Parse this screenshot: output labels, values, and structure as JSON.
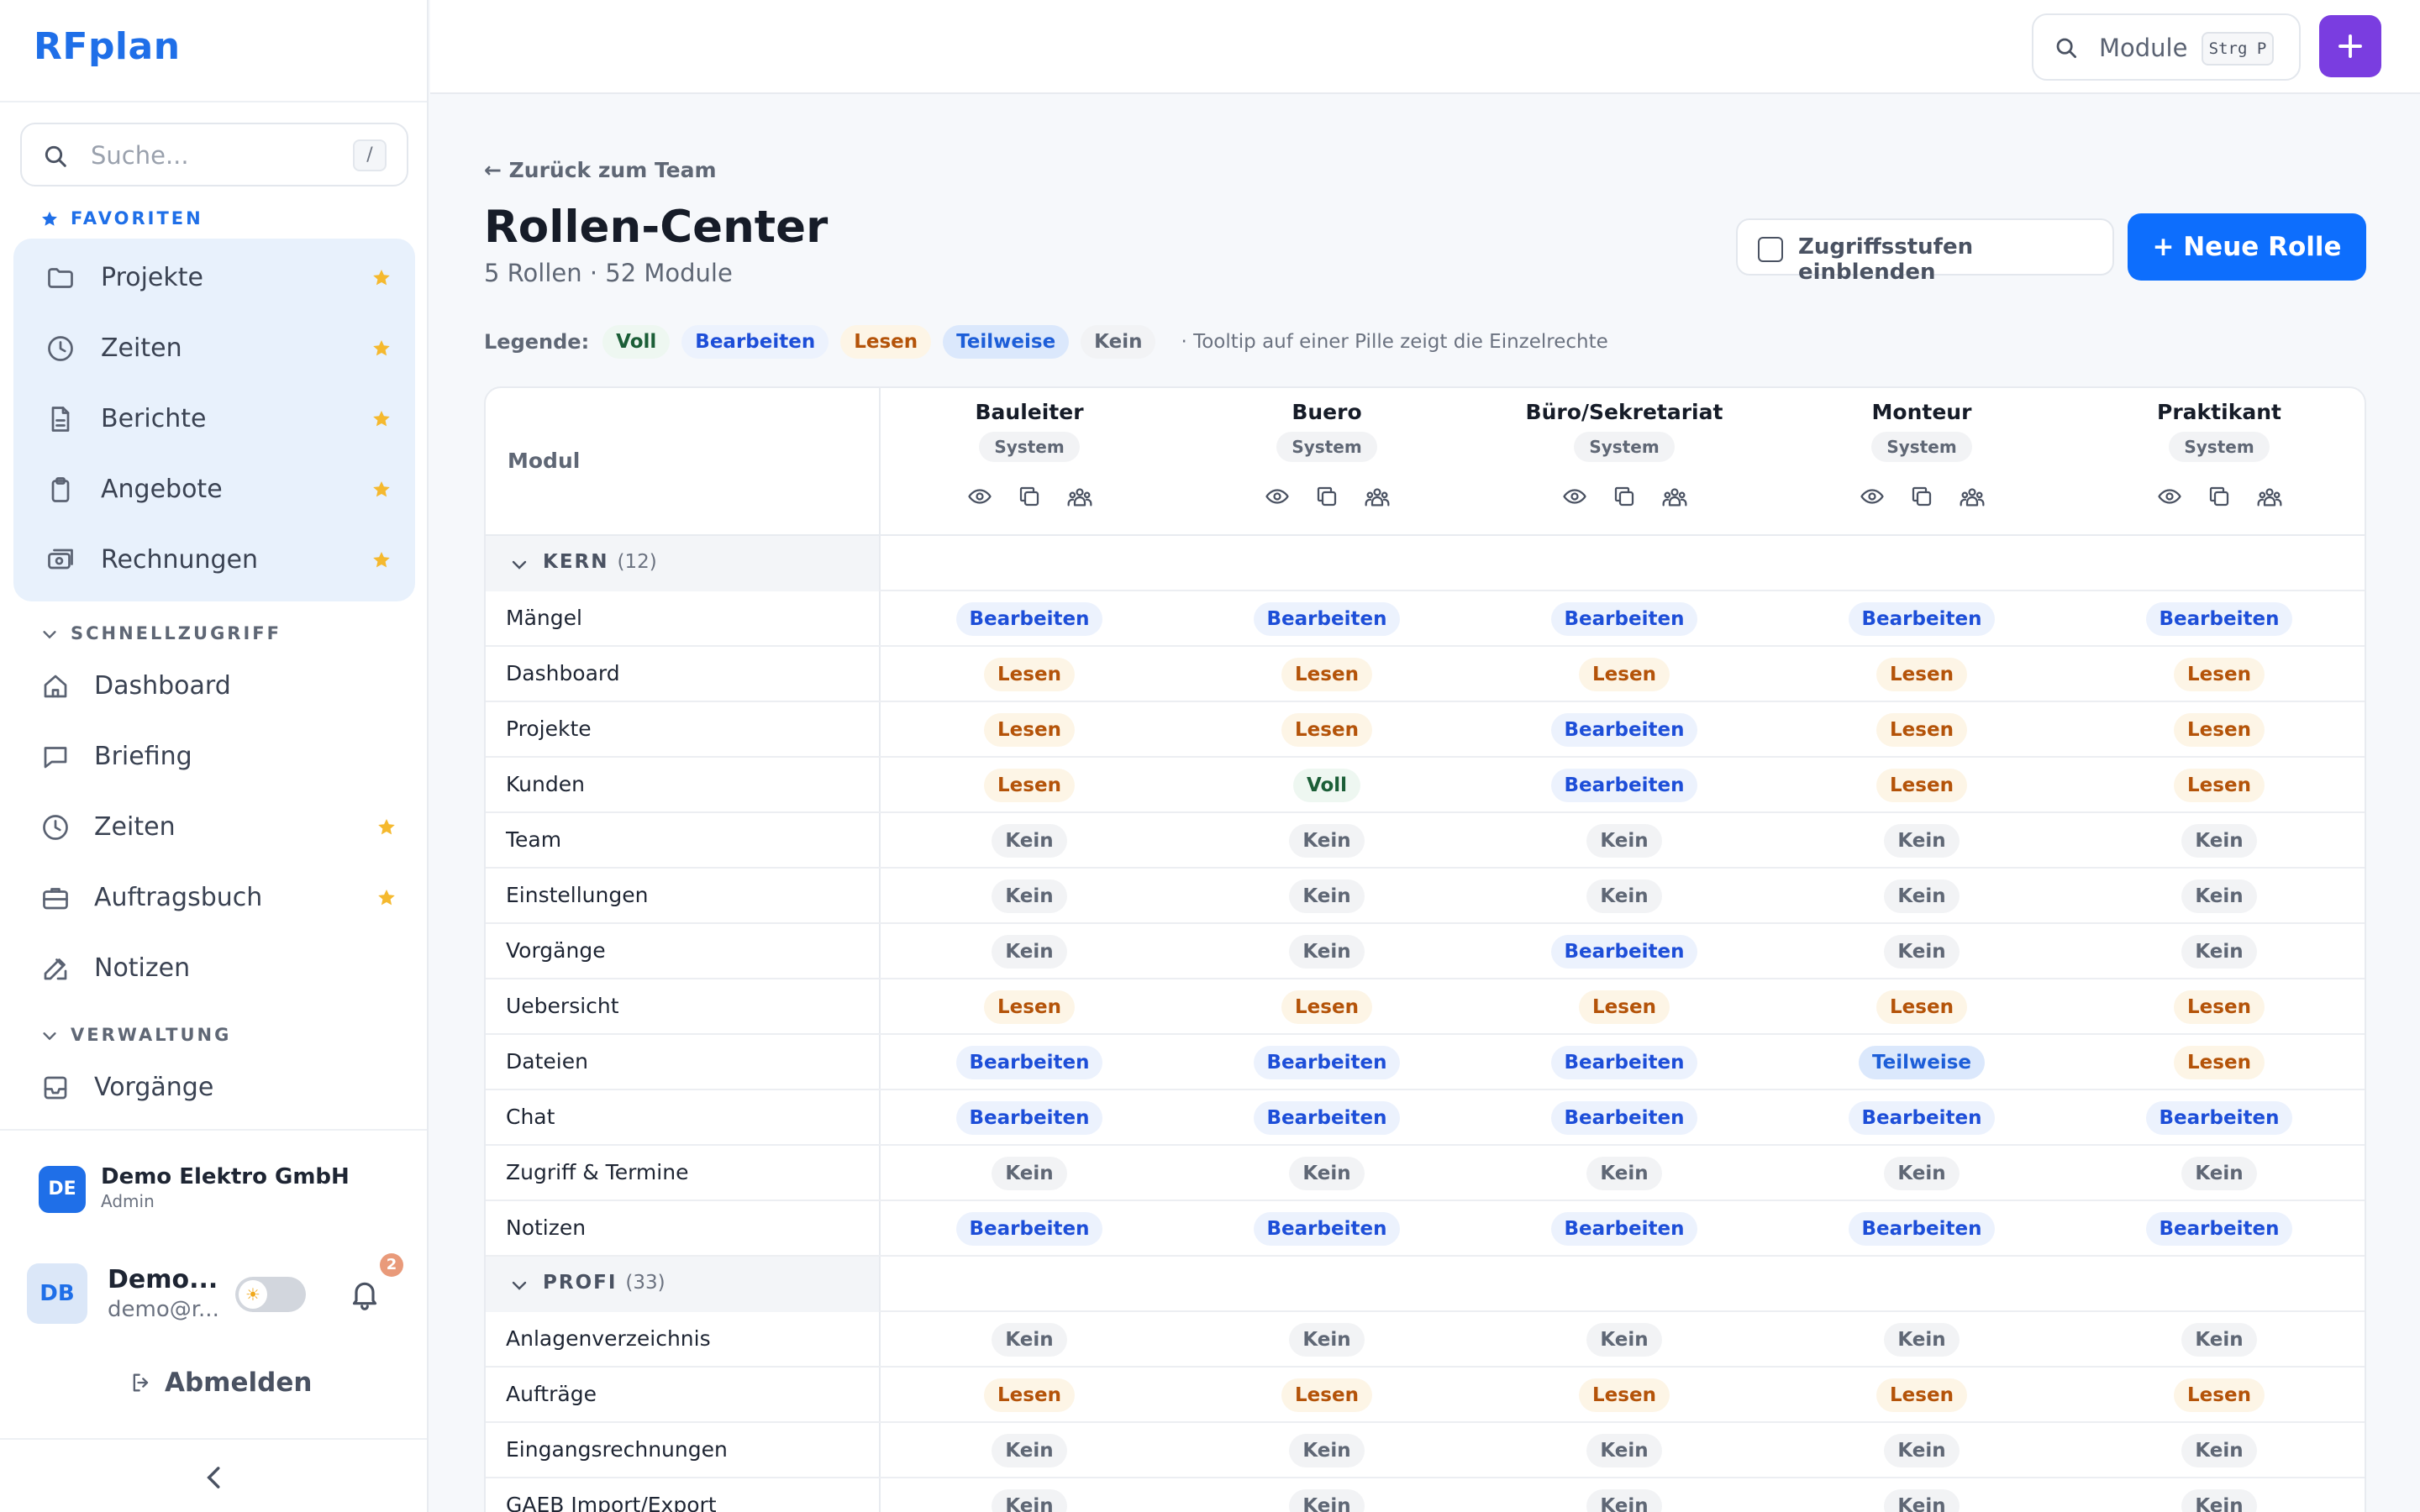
{
  "app": {
    "brand": "RFplan"
  },
  "sidebar": {
    "search": {
      "placeholder": "Suche...",
      "shortcut": "/"
    },
    "favorites": {
      "label": "FAVORITEN",
      "items": [
        {
          "label": "Projekte",
          "icon": "folder-icon",
          "starred": true
        },
        {
          "label": "Zeiten",
          "icon": "clock-icon",
          "starred": true
        },
        {
          "label": "Berichte",
          "icon": "document-icon",
          "starred": true
        },
        {
          "label": "Angebote",
          "icon": "clipboard-icon",
          "starred": true
        },
        {
          "label": "Rechnungen",
          "icon": "money-icon",
          "starred": true
        }
      ]
    },
    "quick": {
      "label": "SCHNELLZUGRIFF",
      "items": [
        {
          "label": "Dashboard",
          "icon": "home-icon",
          "starred": false
        },
        {
          "label": "Briefing",
          "icon": "chat-icon",
          "starred": false
        },
        {
          "label": "Zeiten",
          "icon": "clock-icon",
          "starred": true
        },
        {
          "label": "Auftragsbuch",
          "icon": "briefcase-icon",
          "starred": true
        },
        {
          "label": "Notizen",
          "icon": "edit-icon",
          "starred": false
        }
      ]
    },
    "admin": {
      "label": "VERWALTUNG",
      "items": [
        {
          "label": "Vorgänge",
          "icon": "inbox-icon",
          "starred": false
        }
      ]
    },
    "org": {
      "initials": "DE",
      "name": "Demo Elektro GmbH",
      "role": "Admin"
    },
    "user": {
      "initials": "DB",
      "name": "Demo...",
      "email": "demo@r...",
      "notifications": "2"
    },
    "logout": "Abmelden"
  },
  "topbar": {
    "module_search": "Module",
    "shortcut": "Strg P"
  },
  "page": {
    "back": "← Zurück zum Team",
    "title": "Rollen-Center",
    "subtitle": "5 Rollen · 52 Module",
    "toggle_label": "Zugriffsstufen einblenden",
    "new_role": "+ Neue Rolle"
  },
  "legend": {
    "label": "Legende:",
    "items": [
      "Voll",
      "Bearbeiten",
      "Lesen",
      "Teilweise",
      "Kein"
    ],
    "note": "· Tooltip auf einer Pille zeigt die Einzelrechte"
  },
  "matrix": {
    "module_header": "Modul",
    "roles": [
      {
        "name": "Bauleiter",
        "tag": "System"
      },
      {
        "name": "Buero",
        "tag": "System"
      },
      {
        "name": "Büro/Sekretariat",
        "tag": "System"
      },
      {
        "name": "Monteur",
        "tag": "System"
      },
      {
        "name": "Praktikant",
        "tag": "System"
      }
    ],
    "groups": [
      {
        "name": "KERN",
        "count": "(12)",
        "rows": [
          {
            "module": "Mängel",
            "levels": [
              "Bearbeiten",
              "Bearbeiten",
              "Bearbeiten",
              "Bearbeiten",
              "Bearbeiten"
            ]
          },
          {
            "module": "Dashboard",
            "levels": [
              "Lesen",
              "Lesen",
              "Lesen",
              "Lesen",
              "Lesen"
            ]
          },
          {
            "module": "Projekte",
            "levels": [
              "Lesen",
              "Lesen",
              "Bearbeiten",
              "Lesen",
              "Lesen"
            ]
          },
          {
            "module": "Kunden",
            "levels": [
              "Lesen",
              "Voll",
              "Bearbeiten",
              "Lesen",
              "Lesen"
            ]
          },
          {
            "module": "Team",
            "levels": [
              "Kein",
              "Kein",
              "Kein",
              "Kein",
              "Kein"
            ]
          },
          {
            "module": "Einstellungen",
            "levels": [
              "Kein",
              "Kein",
              "Kein",
              "Kein",
              "Kein"
            ]
          },
          {
            "module": "Vorgänge",
            "levels": [
              "Kein",
              "Kein",
              "Bearbeiten",
              "Kein",
              "Kein"
            ]
          },
          {
            "module": "Uebersicht",
            "levels": [
              "Lesen",
              "Lesen",
              "Lesen",
              "Lesen",
              "Lesen"
            ]
          },
          {
            "module": "Dateien",
            "levels": [
              "Bearbeiten",
              "Bearbeiten",
              "Bearbeiten",
              "Teilweise",
              "Lesen"
            ]
          },
          {
            "module": "Chat",
            "levels": [
              "Bearbeiten",
              "Bearbeiten",
              "Bearbeiten",
              "Bearbeiten",
              "Bearbeiten"
            ]
          },
          {
            "module": "Zugriff & Termine",
            "levels": [
              "Kein",
              "Kein",
              "Kein",
              "Kein",
              "Kein"
            ]
          },
          {
            "module": "Notizen",
            "levels": [
              "Bearbeiten",
              "Bearbeiten",
              "Bearbeiten",
              "Bearbeiten",
              "Bearbeiten"
            ]
          }
        ]
      },
      {
        "name": "PROFI",
        "count": "(33)",
        "rows": [
          {
            "module": "Anlagenverzeichnis",
            "levels": [
              "Kein",
              "Kein",
              "Kein",
              "Kein",
              "Kein"
            ]
          },
          {
            "module": "Aufträge",
            "levels": [
              "Lesen",
              "Lesen",
              "Lesen",
              "Lesen",
              "Lesen"
            ]
          },
          {
            "module": "Eingangsrechnungen",
            "levels": [
              "Kein",
              "Kein",
              "Kein",
              "Kein",
              "Kein"
            ]
          },
          {
            "module": "GAEB Import/Export",
            "levels": [
              "Kein",
              "Kein",
              "Kein",
              "Kein",
              "Kein"
            ]
          }
        ]
      }
    ]
  }
}
